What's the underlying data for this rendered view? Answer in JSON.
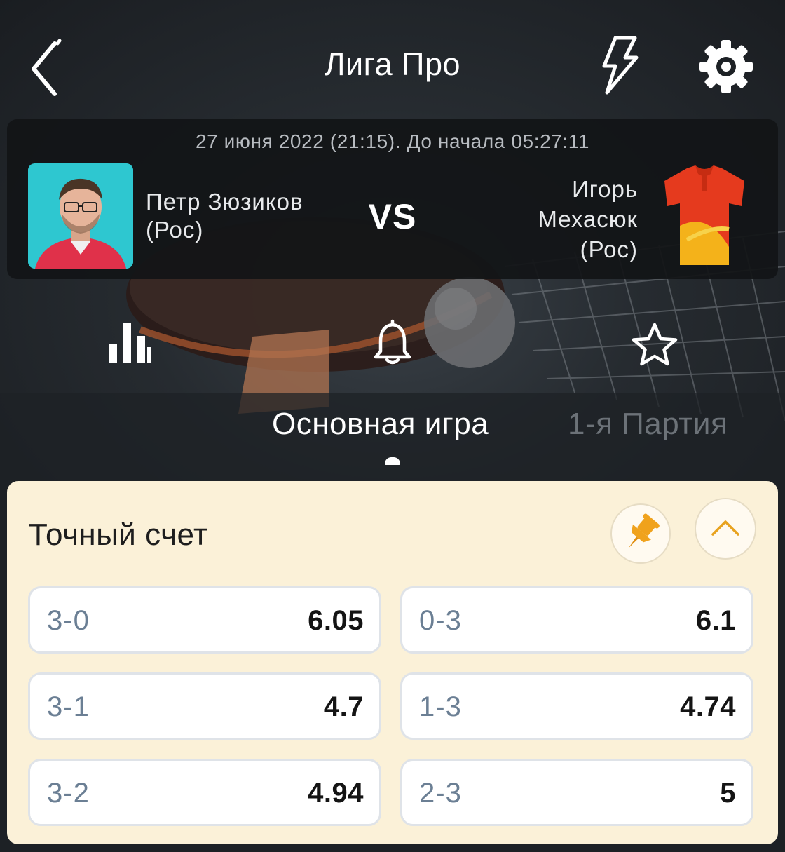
{
  "header": {
    "title": "Лига Про",
    "icons": [
      "back-arrow-icon",
      "lightning-icon",
      "gear-icon"
    ]
  },
  "match": {
    "datetime": "27 июня 2022 (21:15). До начала 05:27:11",
    "vs": "VS",
    "player1": {
      "line1": "Петр Зюзиков",
      "line2": "(Рос)"
    },
    "player2": {
      "line1": "Игорь",
      "line2": "Мехасюк",
      "line3": "(Рос)"
    }
  },
  "actions": [
    "stats-icon",
    "bell-icon",
    "star-icon"
  ],
  "tabs": {
    "main": "Основная игра",
    "set1": "1-я Партия",
    "active": "main"
  },
  "market": {
    "title": "Точный счет",
    "odds": [
      {
        "score": "3-0",
        "value": "6.05"
      },
      {
        "score": "0-3",
        "value": "6.1"
      },
      {
        "score": "3-1",
        "value": "4.7"
      },
      {
        "score": "1-3",
        "value": "4.74"
      },
      {
        "score": "3-2",
        "value": "4.94"
      },
      {
        "score": "2-3",
        "value": "5"
      }
    ]
  },
  "colors": {
    "background": "#1d2125",
    "panel": "#fbf1d8",
    "accent": "#e8a21e",
    "score_text": "#6b7f94"
  }
}
